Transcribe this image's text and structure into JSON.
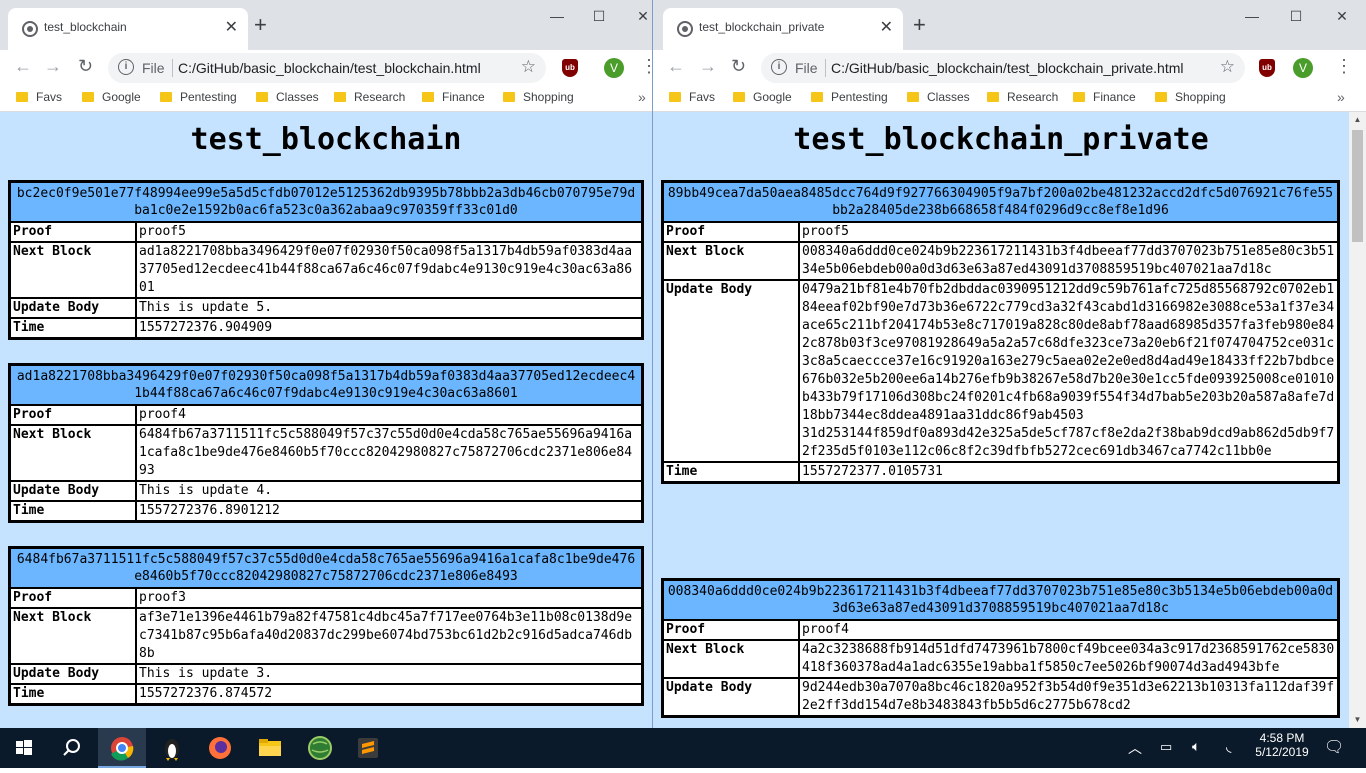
{
  "left": {
    "tab_title": "test_blockchain",
    "url_scheme": "File",
    "url": "C:/GitHub/basic_blockchain/test_blockchain.html",
    "bookmarks": [
      "Favs",
      "Google",
      "Pentesting",
      "Classes",
      "Research",
      "Finance",
      "Shopping"
    ],
    "page_title": "test_blockchain",
    "labels": {
      "proof": "Proof",
      "next": "Next Block",
      "body": "Update Body",
      "time": "Time"
    },
    "blocks": [
      {
        "hash": "bc2ec0f9e501e77f48994ee99e5a5d5cfdb07012e5125362db9395b78bbb2a3db46cb070795e79dba1c0e2e1592b0ac6fa523c0a362abaa9c970359ff33c01d0",
        "proof": "proof5",
        "next": "ad1a8221708bba3496429f0e07f02930f50ca098f5a1317b4db59af0383d4aa37705ed12ecdeec41b44f88ca67a6c46c07f9dabc4e9130c919e4c30ac63a8601",
        "body": "This is update 5.",
        "time": "1557272376.904909"
      },
      {
        "hash": "ad1a8221708bba3496429f0e07f02930f50ca098f5a1317b4db59af0383d4aa37705ed12ecdeec41b44f88ca67a6c46c07f9dabc4e9130c919e4c30ac63a8601",
        "proof": "proof4",
        "next": "6484fb67a3711511fc5c588049f57c37c55d0d0e4cda58c765ae55696a9416a1cafa8c1be9de476e8460b5f70ccc82042980827c75872706cdc2371e806e8493",
        "body": "This is update 4.",
        "time": "1557272376.8901212"
      },
      {
        "hash": "6484fb67a3711511fc5c588049f57c37c55d0d0e4cda58c765ae55696a9416a1cafa8c1be9de476e8460b5f70ccc82042980827c75872706cdc2371e806e8493",
        "proof": "proof3",
        "next": "af3e71e1396e4461b79a82f47581c4dbc45a7f717ee0764b3e11b08c0138d9ec7341b87c95b6afa40d20837dc299be6074bd753bc61d2b2c916d5adca746db8b",
        "body": "This is update 3.",
        "time": "1557272376.874572"
      }
    ]
  },
  "right": {
    "tab_title": "test_blockchain_private",
    "url_scheme": "File",
    "url": "C:/GitHub/basic_blockchain/test_blockchain_private.html",
    "bookmarks": [
      "Favs",
      "Google",
      "Pentesting",
      "Classes",
      "Research",
      "Finance",
      "Shopping"
    ],
    "page_title": "test_blockchain_private",
    "labels": {
      "proof": "Proof",
      "next": "Next Block",
      "body": "Update Body",
      "time": "Time"
    },
    "blocks": [
      {
        "hash": "89bb49cea7da50aea8485dcc764d9f927766304905f9a7bf200a02be481232accd2dfc5d076921c76fe55bb2a28405de238b668658f484f0296d9cc8ef8e1d96",
        "proof": "proof5",
        "next": "008340a6ddd0ce024b9b223617211431b3f4dbeeaf77dd3707023b751e85e80c3b5134e5b06ebdeb00a0d3d63e63a87ed43091d3708859519bc407021aa7d18c",
        "body": "0479a21bf81e4b70fb2dbddac0390951212dd9c59b761afc725d85568792c0702eb184eeaf02bf90e7d73b36e6722c779cd3a32f43cabd1d3166982e3088ce53a1f37e34ace65c211bf204174b53e8c717019a828c80de8abf78aad68985d357fa3feb980e842c878b03f3ce97081928649a5a2a57c68dfe323ce73a20eb6f21f074704752ce031c3c8a5caeccce37e16c91920a163e279c5aea02e2e0ed8d4ad49e18433ff22b7bdbce676b032e5b200ee6a14b276efb9b38267e58d7b20e30e1cc5fde093925008ce01010b433b79f17106d308bc24f0201c4fb68a9039f554f34d7bab5e203b20a587a8afe7d18bb7344ec8ddea4891aa31ddc86f9ab4503",
        "body2": "31d253144f859df0a893d42e325a5de5cf787cf8e2da2f38bab9dcd9ab862d5db9f72f235d5f0103e112c06c8f2c39dfbfb5272cec691db3467ca7742c11bb0e",
        "time": "1557272377.0105731"
      },
      {
        "hash": "008340a6ddd0ce024b9b223617211431b3f4dbeeaf77dd3707023b751e85e80c3b5134e5b06ebdeb00a0d3d63e63a87ed43091d3708859519bc407021aa7d18c",
        "proof": "proof4",
        "next": "4a2c3238688fb914d51dfd7473961b7800cf49bcee034a3c917d2368591762ce5830418f360378ad4a1adc6355e19abba1f5850c7ee5026bf90074d3ad4943bfe",
        "body": "9d244edb30a7070a8bc46c1820a952f3b54d0f9e351d3e62213b10313fa112daf39f2e2ff3dd154d7e8b3483843fb5b5d6c2775b678cd2"
      }
    ]
  },
  "taskbar": {
    "time": "4:58 PM",
    "date": "5/12/2019"
  },
  "colors": {
    "page_bg": "#c5e2ff",
    "hash_bg": "#6bb6ff"
  }
}
